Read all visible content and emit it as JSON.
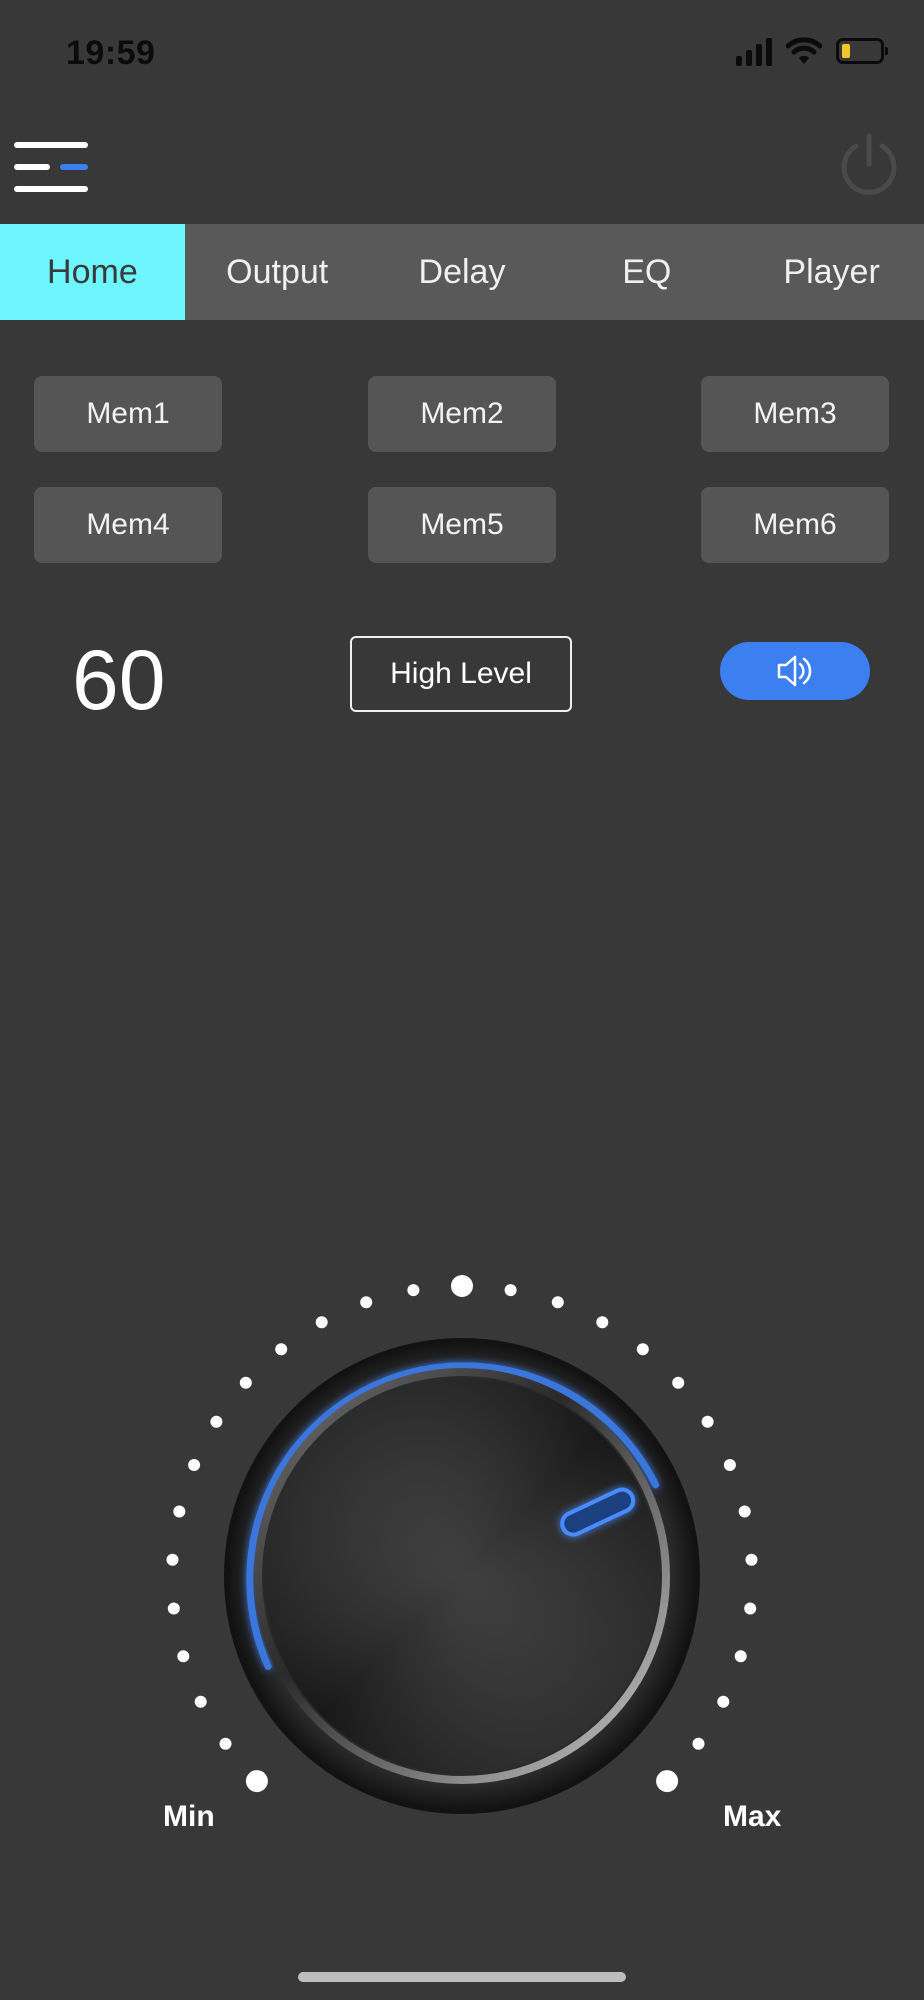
{
  "status_bar": {
    "time": "19:59",
    "icons": [
      "cellular-signal-icon",
      "wifi-icon",
      "battery-low-icon"
    ]
  },
  "header": {
    "menu_icon": "menu-icon",
    "power_icon": "power-icon"
  },
  "tabs": [
    {
      "label": "Home",
      "active": true
    },
    {
      "label": "Output",
      "active": false
    },
    {
      "label": "Delay",
      "active": false
    },
    {
      "label": "EQ",
      "active": false
    },
    {
      "label": "Player",
      "active": false
    }
  ],
  "memories": [
    "Mem1",
    "Mem2",
    "Mem3",
    "Mem4",
    "Mem5",
    "Mem6"
  ],
  "volume": {
    "value": "60",
    "input_level": "High Level",
    "speaker_icon": "speaker-icon"
  },
  "knob": {
    "min_label": "Min",
    "max_label": "Max",
    "level_fraction": 0.74
  },
  "colors": {
    "background": "#383838",
    "tab_bar": "#595959",
    "active_tab": "#6ef6ff",
    "accent_blue": "#3c7ff0",
    "button_gray": "#555555"
  }
}
